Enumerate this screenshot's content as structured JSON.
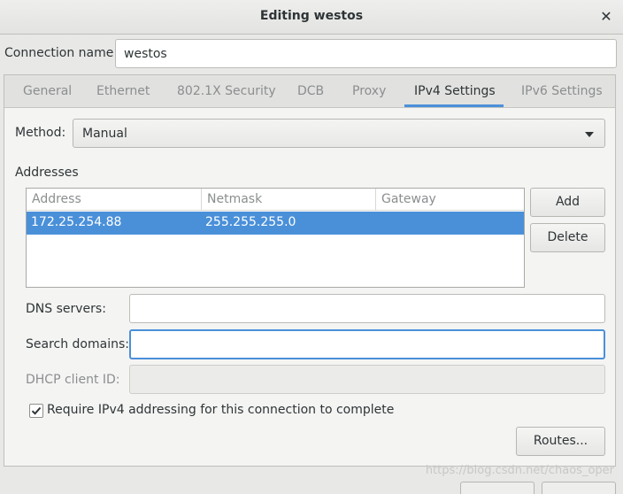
{
  "window": {
    "title": "Editing westos"
  },
  "connection": {
    "label": "Connection name:",
    "value": "westos"
  },
  "tabs": [
    {
      "label": "General"
    },
    {
      "label": "Ethernet"
    },
    {
      "label": "802.1X Security"
    },
    {
      "label": "DCB"
    },
    {
      "label": "Proxy"
    },
    {
      "label": "IPv4 Settings"
    },
    {
      "label": "IPv6 Settings"
    }
  ],
  "active_tab": "IPv4 Settings",
  "method": {
    "label": "Method:",
    "value": "Manual"
  },
  "addresses": {
    "title": "Addresses",
    "columns": [
      "Address",
      "Netmask",
      "Gateway"
    ],
    "rows": [
      {
        "address": "172.25.254.88",
        "netmask": "255.255.255.0",
        "gateway": ""
      }
    ],
    "add_label": "Add",
    "delete_label": "Delete"
  },
  "dns": {
    "label": "DNS servers:",
    "value": ""
  },
  "search": {
    "label": "Search domains:",
    "value": ""
  },
  "dhcp": {
    "label": "DHCP client ID:",
    "value": ""
  },
  "require": {
    "label": "Require IPv4 addressing for this connection to complete",
    "checked": true
  },
  "routes_label": "Routes...",
  "watermark": "https://blog.csdn.net/chaos_oper",
  "colors": {
    "accent": "#4a90d9",
    "selection": "#4a90d9"
  }
}
